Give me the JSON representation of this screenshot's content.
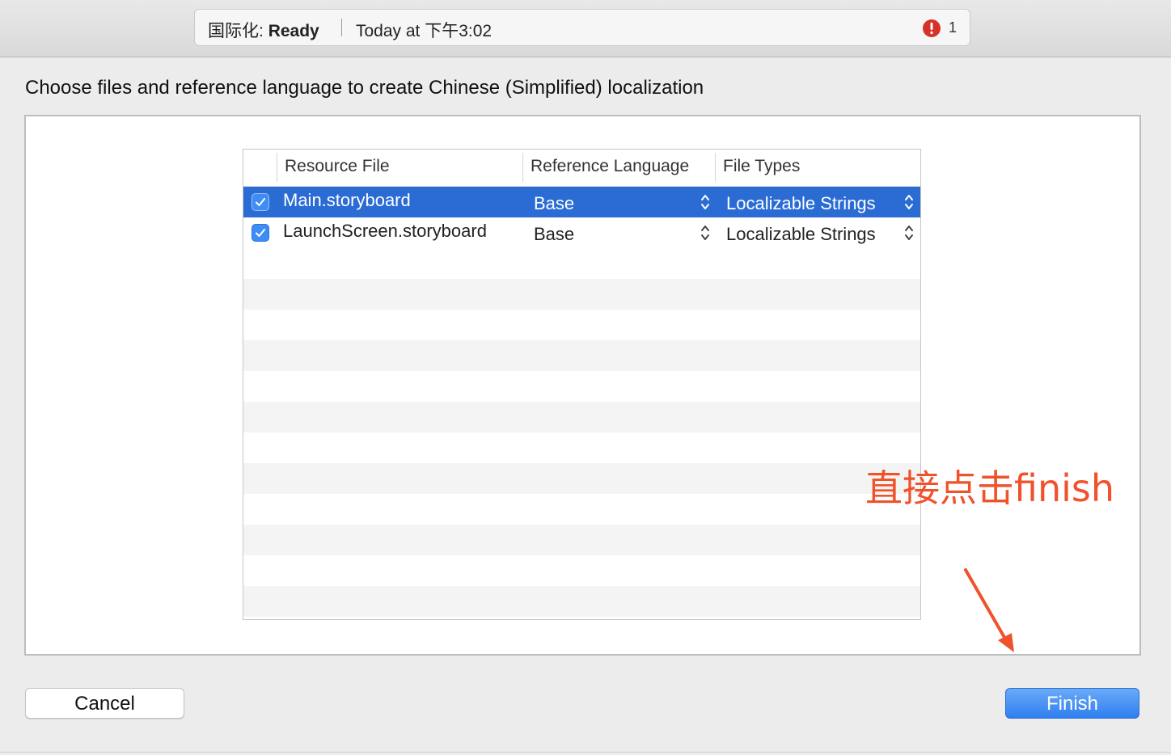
{
  "toolbar": {
    "scheme_name": "国际化:",
    "status": "Ready",
    "timestamp": "Today at 下午3:02",
    "error_count": "1"
  },
  "dialog": {
    "heading": "Choose files and reference language to create Chinese (Simplified) localization",
    "columns": [
      "Resource File",
      "Reference Language",
      "File Types"
    ],
    "rows": [
      {
        "checked": true,
        "file": "Main.storyboard",
        "language": "Base",
        "type": "Localizable Strings",
        "selected": true
      },
      {
        "checked": true,
        "file": "LaunchScreen.storyboard",
        "language": "Base",
        "type": "Localizable Strings",
        "selected": false
      }
    ],
    "cancel_label": "Cancel",
    "finish_label": "Finish"
  },
  "annotation": {
    "text": "直接点击finish",
    "color": "#f0522b"
  },
  "colors": {
    "selection": "#2b6cd4",
    "checkbox": "#3d8df5",
    "error": "#d7322a",
    "finish_button": "#2f7ff0"
  },
  "icons": {
    "error": "exclamation-circle-icon",
    "checkbox": "checkmark-icon",
    "stepper": "up-down-chevron-icon"
  }
}
